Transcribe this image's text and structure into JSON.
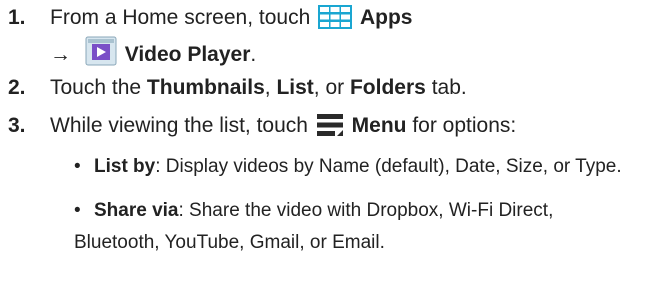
{
  "steps": [
    {
      "number": "1.",
      "line1_pre": "From a Home screen, touch",
      "apps_icon": "apps-grid-icon",
      "apps_label": "Apps",
      "arrow": "→",
      "video_icon": "video-player-icon",
      "video_label": "Video Player",
      "period": "."
    },
    {
      "number": "2.",
      "pre": "Touch the",
      "thumbnails": "Thumbnails",
      "comma1": ",",
      "list": "List",
      "or": ", or",
      "folders": "Folders",
      "post": "tab."
    },
    {
      "number": "3.",
      "pre": "While viewing the list, touch",
      "menu_icon": "menu-icon",
      "menu_label": "Menu",
      "post": "for options:"
    }
  ],
  "bullets": [
    {
      "bullet": "•",
      "term": "List by",
      "desc": ": Display videos by Name (default), Date, Size, or Type."
    },
    {
      "bullet": "•",
      "term": "Share via",
      "desc": ": Share the video with Dropbox, Wi-Fi Direct,",
      "desc_line2": "Bluetooth, YouTube, Gmail, or Email."
    }
  ]
}
